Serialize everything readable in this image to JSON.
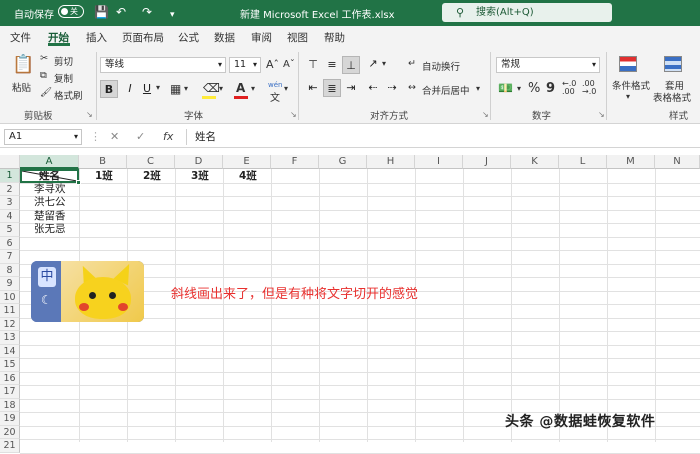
{
  "titlebar": {
    "autosave_label": "自动保存",
    "autosave_state": "关",
    "doc_title": "新建 Microsoft Excel 工作表.xlsx",
    "search_placeholder": "搜索(Alt+Q)",
    "icons": [
      "save-icon",
      "undo-icon",
      "redo-icon",
      "customize-icon",
      "search-icon"
    ]
  },
  "menu": {
    "items": [
      "文件",
      "开始",
      "插入",
      "页面布局",
      "公式",
      "数据",
      "审阅",
      "视图",
      "帮助"
    ],
    "active": "开始"
  },
  "ribbon": {
    "clipboard": {
      "paste": "粘贴",
      "cut": "剪切",
      "copy": "复制",
      "format_painter": "格式刷",
      "group": "剪贴板"
    },
    "font": {
      "name": "等线",
      "size": "11",
      "bold": "B",
      "italic": "I",
      "underline": "U",
      "phonetic": "wén",
      "group": "字体"
    },
    "alignment": {
      "wrap": "自动换行",
      "merge": "合并后居中",
      "group": "对齐方式"
    },
    "number": {
      "format": "常规",
      "percent": "%",
      "comma": "9",
      "group": "数字"
    },
    "styles": {
      "conditional": "条件格式",
      "table_format_1": "套用",
      "table_format_2": "表格格式",
      "group": "样式"
    }
  },
  "formula_bar": {
    "cell_ref": "A1",
    "cancel": "✕",
    "enter": "✓",
    "fx": "fx",
    "content": "姓名"
  },
  "sheet": {
    "columns": [
      "A",
      "B",
      "C",
      "D",
      "E",
      "F",
      "G",
      "H",
      "I",
      "J",
      "K",
      "L",
      "M",
      "N"
    ],
    "rows": [
      "1",
      "2",
      "3",
      "4",
      "5",
      "6",
      "7",
      "8",
      "9",
      "10",
      "11",
      "12",
      "13",
      "14",
      "15",
      "16",
      "17",
      "18",
      "19",
      "20",
      "21"
    ],
    "cells": {
      "A1": "姓名",
      "B1": "1班",
      "C1": "2班",
      "D1": "3班",
      "E1": "4班",
      "A2": "李寻欢",
      "A3": "洪七公",
      "A4": "楚留香",
      "A5": "张无忌"
    }
  },
  "picture": {
    "ime_char": "中"
  },
  "annotation": "斜线画出来了，但是有种将文字切开的感觉",
  "watermark": "头条 @数据蛙恢复软件",
  "colors": {
    "excel_green": "#217346",
    "annotation_red": "#e8312f",
    "font_color_red": "#e02020",
    "fill_yellow": "#ffeb3b"
  }
}
